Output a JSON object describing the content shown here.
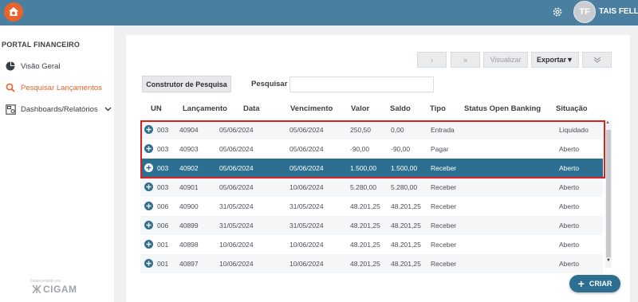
{
  "header": {
    "user_initials": "TF",
    "user_name": "TAIS FELLES"
  },
  "sidebar": {
    "brand": "PORTAL FINANCEIRO",
    "items": [
      {
        "label": "Visão Geral",
        "icon": "pie-chart-icon"
      },
      {
        "label": "Pesquisar Lançamentos",
        "icon": "search-icon",
        "active": true
      },
      {
        "label": "Dashboards/Relatórios",
        "icon": "dashboard-icon"
      }
    ],
    "footer_small": "Desenvolvido por",
    "footer_logo": "CIGAM"
  },
  "toolbar": {
    "next": "›",
    "last": "»",
    "visualize": "Visualizar",
    "export": "Exportar▼",
    "expand": "⌄"
  },
  "search": {
    "builder_label": "Construtor de Pesquisa",
    "label": "Pesquisar",
    "value": "",
    "placeholder": ""
  },
  "table": {
    "headers": [
      "UN",
      "Lançamento",
      "Data",
      "Vencimento",
      "Valor",
      "Saldo",
      "Tipo",
      "Status Open Banking",
      "Situação"
    ],
    "rows": [
      {
        "un": "003",
        "lanc": "40904",
        "data": "05/06/2024",
        "venc": "05/06/2024",
        "valor": "250,50",
        "saldo": "0,00",
        "tipo": "Entrada",
        "status": "",
        "sit": "Liquidado"
      },
      {
        "un": "003",
        "lanc": "40903",
        "data": "05/06/2024",
        "venc": "05/06/2024",
        "valor": "-90,00",
        "saldo": "-90,00",
        "tipo": "Pagar",
        "status": "",
        "sit": "Aberto"
      },
      {
        "un": "003",
        "lanc": "40902",
        "data": "05/06/2024",
        "venc": "05/06/2024",
        "valor": "1.500,00",
        "saldo": "1.500,00",
        "tipo": "Receber",
        "status": "",
        "sit": "Aberto"
      },
      {
        "un": "003",
        "lanc": "40901",
        "data": "05/06/2024",
        "venc": "10/06/2024",
        "valor": "5.280,00",
        "saldo": "5.280,00",
        "tipo": "Receber",
        "status": "",
        "sit": "Aberto"
      },
      {
        "un": "006",
        "lanc": "40900",
        "data": "31/05/2024",
        "venc": "31/05/2024",
        "valor": "48.201,25",
        "saldo": "48.201,25",
        "tipo": "Receber",
        "status": "",
        "sit": "Aberto"
      },
      {
        "un": "006",
        "lanc": "40899",
        "data": "31/05/2024",
        "venc": "31/05/2024",
        "valor": "48.201,25",
        "saldo": "48.201,25",
        "tipo": "Receber",
        "status": "",
        "sit": "Aberto"
      },
      {
        "un": "001",
        "lanc": "40898",
        "data": "10/06/2024",
        "venc": "10/06/2024",
        "valor": "48.201,25",
        "saldo": "48.201,25",
        "tipo": "Receber",
        "status": "",
        "sit": "Aberto"
      },
      {
        "un": "001",
        "lanc": "40897",
        "data": "10/06/2024",
        "venc": "10/06/2024",
        "valor": "48.201,25",
        "saldo": "48.201,25",
        "tipo": "Receber",
        "status": "",
        "sit": "Aberto"
      }
    ],
    "selected_row": 2
  },
  "fab": {
    "label": "CRIAR"
  },
  "colors": {
    "topbar": "#4a7fa0",
    "accent": "#e8642c",
    "primary": "#2d6f90",
    "highlight_border": "#e02020"
  }
}
